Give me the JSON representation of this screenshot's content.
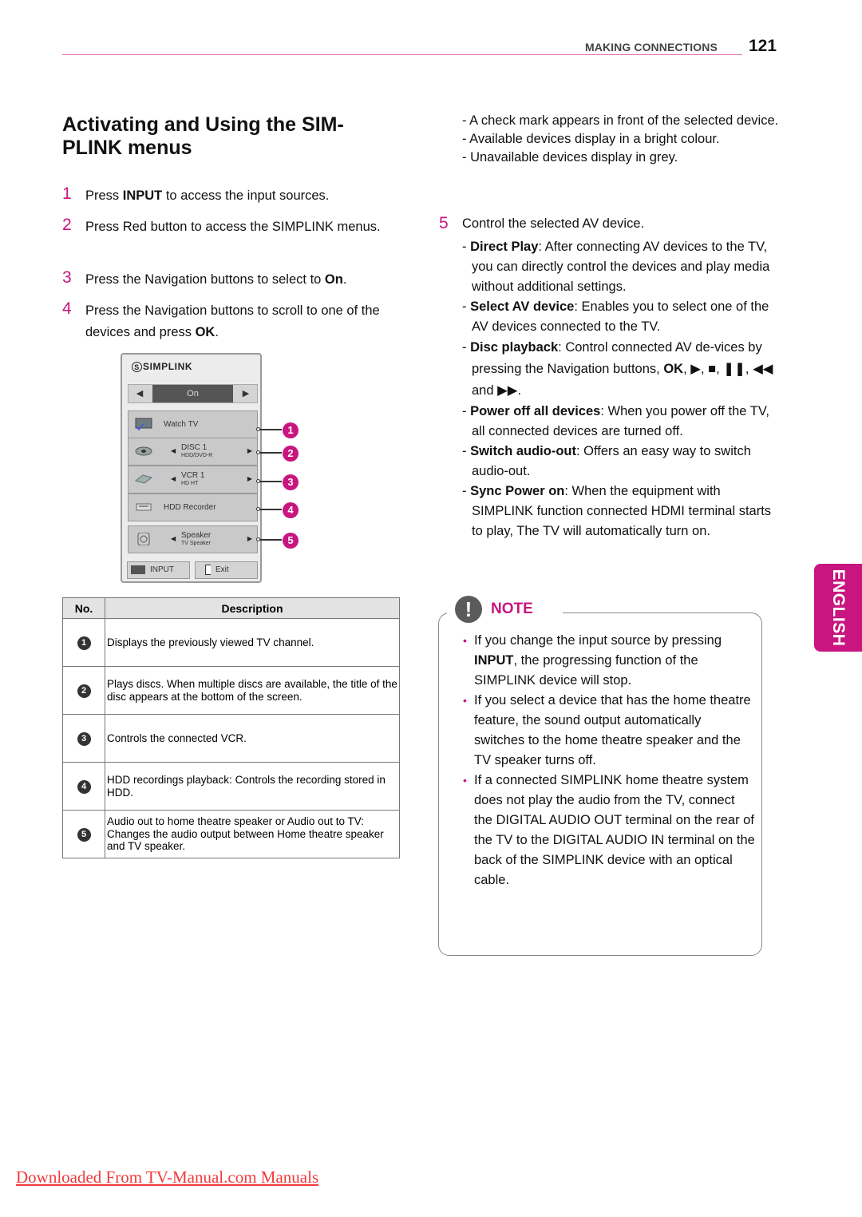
{
  "header": {
    "section": "MAKING CONNECTIONS",
    "page_number": "121",
    "accent_color": "#c8157f"
  },
  "title": "Activating and Using the SIM-PLINK menus",
  "title_lines": [
    "Activating and Using the SIM-",
    "PLINK menus"
  ],
  "steps": [
    {
      "num": "1",
      "pre": "Press ",
      "bold": "INPUT",
      "post": " to access the input sources."
    },
    {
      "num": "2",
      "pre": "Press Red button to access the SIMPLINK menus.",
      "bold": "",
      "post": ""
    },
    {
      "num": "3",
      "pre": "Press the Navigation buttons to select to ",
      "bold": "On",
      "post": "."
    },
    {
      "num": "4",
      "pre": "Press the Navigation buttons to scroll to one of the devices and press ",
      "bold": "OK",
      "post": "."
    }
  ],
  "osd": {
    "logo": "SIMPLINK",
    "toggle_value": "On",
    "rows": [
      {
        "name": "Watch TV",
        "sub": "",
        "icon": "tv-icon",
        "checked": true
      },
      {
        "name": "DISC 1",
        "sub": "HDD/DVD-R",
        "icon": "disc-icon"
      },
      {
        "name": "VCR 1",
        "sub": "HD HT",
        "icon": "vcr-icon"
      },
      {
        "name": "HDD Recorder",
        "sub": "",
        "icon": "hdd-icon"
      },
      {
        "name": "Speaker",
        "sub": "TV Speaker",
        "icon": "speaker-icon"
      }
    ],
    "input_label": "INPUT",
    "exit_label": "Exit",
    "callouts": [
      "1",
      "2",
      "3",
      "4",
      "5"
    ]
  },
  "table": {
    "headers": [
      "No.",
      "Description"
    ],
    "rows": [
      {
        "no": "1",
        "desc": "Displays the previously viewed TV channel."
      },
      {
        "no": "2",
        "desc": "Plays discs. When multiple discs are available, the title of the disc appears at the bottom of the screen."
      },
      {
        "no": "3",
        "desc": "Controls the connected VCR."
      },
      {
        "no": "4",
        "desc": "HDD recordings playback: Controls the recording stored in HDD."
      },
      {
        "no": "5",
        "desc": "Audio out to home theatre speaker or Audio out to TV: Changes the audio output between Home theatre speaker and TV speaker."
      }
    ]
  },
  "right": {
    "step4_notes": [
      "- A check mark appears in front of the selected device.",
      "- Available devices display in a bright colour.",
      "- Unavailable devices display in grey."
    ],
    "step5": {
      "num": "5",
      "text": "Control the selected AV device."
    },
    "features": [
      {
        "bold": "Direct Play",
        "text": ": After connecting AV devices to the TV, you can directly control the devices and play media without additional settings."
      },
      {
        "bold": "Select AV device",
        "text": ": Enables you to select one of the AV devices connected to the TV."
      },
      {
        "bold": "Disc playback",
        "text": ": Control connected AV de-vices by pressing the Navigation buttons, ",
        "bold2": "OK",
        "text2": ",",
        "symbols": "▶, ■, ❚❚, ◀◀ and ▶▶."
      },
      {
        "bold": "Power off all devices",
        "text": ": When you power off the TV, all connected devices are turned off."
      },
      {
        "bold": "Switch audio-out",
        "text": ": Offers an easy way to switch audio-out."
      },
      {
        "bold": "Sync Power on",
        "text": ": When the equipment with SIMPLINK function connected HDMI terminal starts to play, The TV will automatically turn on."
      }
    ]
  },
  "note": {
    "title": "NOTE",
    "items": [
      {
        "pre": "If you change the input source by pressing ",
        "bold": "INPUT",
        "post": ", the progressing function of the SIMPLINK device will stop."
      },
      {
        "pre": "If you select a device that has the home theatre feature, the sound output automatically switches to the home theatre speaker and the TV speaker turns off.",
        "bold": "",
        "post": ""
      },
      {
        "pre": "If a connected SIMPLINK home theatre system does not play the audio from the TV, connect the DIGITAL AUDIO OUT terminal on the rear of the TV to the DIGITAL AUDIO IN terminal on the back of the SIMPLINK device with an optical cable.",
        "bold": "",
        "post": ""
      }
    ]
  },
  "language_tab": "ENGLISH",
  "footer_link": "Downloaded From TV-Manual.com Manuals"
}
